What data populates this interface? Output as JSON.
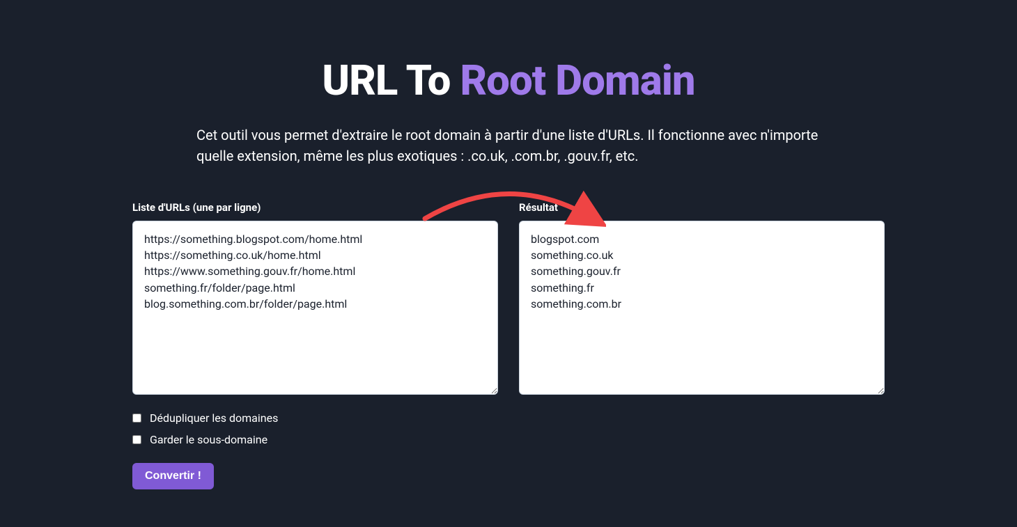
{
  "header": {
    "title_part1": "URL To ",
    "title_part2": "Root Domain"
  },
  "description": "Cet outil vous permet d'extraire le root domain à partir d'une liste d'URLs. Il fonctionne avec n'importe quelle extension, même les plus exotiques : .co.uk, .com.br, .gouv.fr, etc.",
  "input": {
    "label": "Liste d'URLs (une par ligne)",
    "value": "https://something.blogspot.com/home.html\nhttps://something.co.uk/home.html\nhttps://www.something.gouv.fr/home.html\nsomething.fr/folder/page.html\nblog.something.com.br/folder/page.html"
  },
  "output": {
    "label": "Résultat",
    "value": "blogspot.com\nsomething.co.uk\nsomething.gouv.fr\nsomething.fr\nsomething.com.br"
  },
  "options": {
    "dedupe_label": "Dédupliquer les domaines",
    "dedupe_checked": false,
    "keep_subdomain_label": "Garder le sous-domaine",
    "keep_subdomain_checked": false
  },
  "actions": {
    "convert_label": "Convertir !"
  },
  "colors": {
    "background": "#1a202c",
    "accent": "#9f7aea",
    "button": "#805ad5",
    "arrow": "#ef4444"
  }
}
